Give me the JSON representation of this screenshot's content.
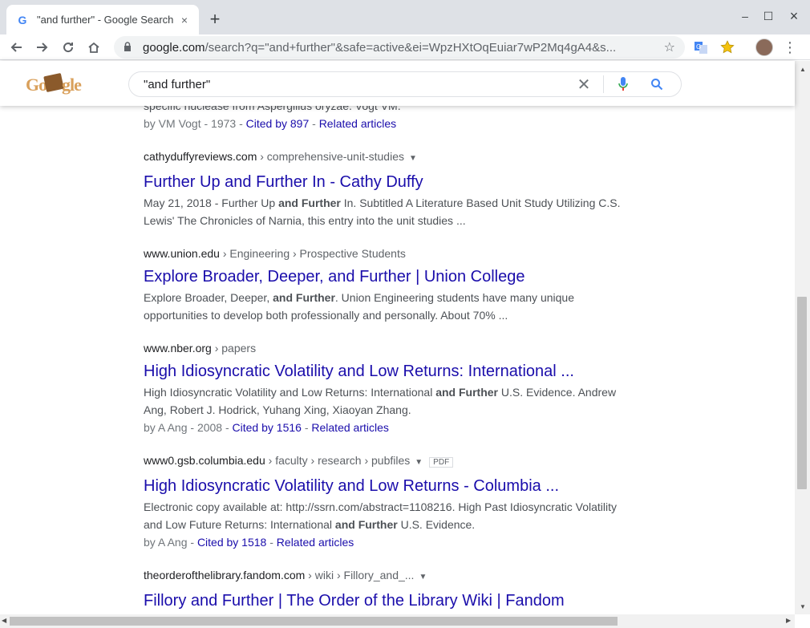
{
  "tab": {
    "title": "\"and further\" - Google Search",
    "close": "×",
    "newtab": "+"
  },
  "window": {
    "min": "–",
    "max": "☐",
    "close": "×"
  },
  "omnibox": {
    "domain": "google.com",
    "rest": "/search?q=\"and+further\"&safe=active&ei=WpzHXtOqEuiar7wP2Mq4gA4&s..."
  },
  "search": {
    "query": "\"and further\"",
    "logo_text": "Google"
  },
  "results": [
    {
      "partial_top": "specific nuclease from Aspergillus oryzae. Vogt VM.",
      "meta_prefix": "by VM Vogt - 1973 - ",
      "cited": "Cited by 897",
      "related": "Related articles"
    },
    {
      "site": "cathyduffyreviews.com",
      "path": " › comprehensive-unit-studies",
      "title": "Further Up and Further In - Cathy Duffy",
      "snippet": "May 21, 2018 - Further Up and Further In. Subtitled A Literature Based Unit Study Utilizing C.S. Lewis' The Chronicles of Narnia, this entry into the unit studies ..."
    },
    {
      "site": "www.union.edu",
      "path": " › Engineering › Prospective Students",
      "title": "Explore Broader, Deeper, and Further | Union College",
      "snippet": "Explore Broader, Deeper, and Further. Union Engineering students have many unique opportunities to develop both professionally and personally. About 70% ..."
    },
    {
      "site": "www.nber.org",
      "path": " › papers",
      "title": "High Idiosyncratic Volatility and Low Returns: International ...",
      "snippet": "High Idiosyncratic Volatility and Low Returns: International and Further U.S. Evidence. Andrew Ang, Robert J. Hodrick, Yuhang Xing, Xiaoyan Zhang.",
      "meta_prefix": "by A Ang - 2008 - ",
      "cited": "Cited by 1516",
      "related": "Related articles"
    },
    {
      "site": "www0.gsb.columbia.edu",
      "path": " › faculty › research › pubfiles",
      "pdf": "PDF",
      "title": "High Idiosyncratic Volatility and Low Returns - Columbia ...",
      "snippet": "Electronic copy available at: http://ssrn.com/abstract=1108216. High Past Idiosyncratic Volatility and Low Future Returns: International and Further U.S. Evidence.",
      "meta_prefix": "by A Ang - ",
      "cited": "Cited by 1518",
      "related": "Related articles"
    },
    {
      "site": "theorderofthelibrary.fandom.com",
      "path": " › wiki › Fillory_and_...",
      "title": "Fillory and Further | The Order of the Library Wiki | Fandom"
    }
  ],
  "icons": {
    "back": "back-arrow-icon",
    "forward": "forward-arrow-icon",
    "reload": "reload-icon",
    "home": "home-icon",
    "lock": "lock-icon",
    "star": "bookmark-star-icon",
    "translate": "translate-icon",
    "extension": "extension-star-icon",
    "menu": "kebab-menu-icon",
    "mic": "microphone-icon",
    "search": "search-icon",
    "clear": "clear-icon"
  },
  "colors": {
    "link": "#1a0dab",
    "snippet": "#4d5156",
    "cite": "#202124",
    "tabbar": "#dee1e6"
  }
}
